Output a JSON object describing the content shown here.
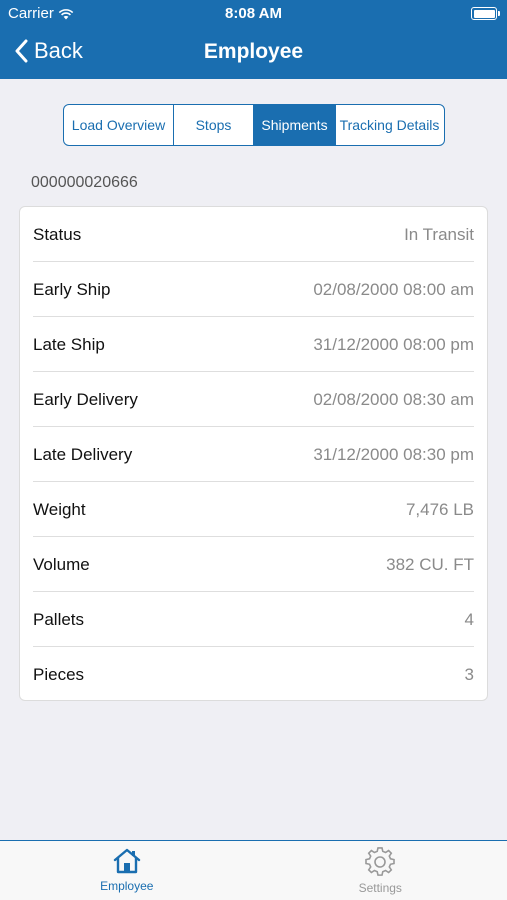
{
  "status_bar": {
    "carrier": "Carrier",
    "time": "8:08 AM"
  },
  "nav": {
    "back_label": "Back",
    "title": "Employee"
  },
  "segments": [
    {
      "label": "Load Overview",
      "active": false
    },
    {
      "label": "Stops",
      "active": false
    },
    {
      "label": "Shipments",
      "active": true
    },
    {
      "label": "Tracking Details",
      "active": false
    }
  ],
  "shipment_id": "000000020666",
  "details": [
    {
      "label": "Status",
      "value": "In Transit"
    },
    {
      "label": "Early Ship",
      "value": "02/08/2000 08:00 am"
    },
    {
      "label": "Late Ship",
      "value": "31/12/2000 08:00 pm"
    },
    {
      "label": "Early Delivery",
      "value": "02/08/2000 08:30 am"
    },
    {
      "label": "Late Delivery",
      "value": "31/12/2000 08:30 pm"
    },
    {
      "label": "Weight",
      "value": "7,476 LB"
    },
    {
      "label": "Volume",
      "value": "382 CU. FT"
    },
    {
      "label": "Pallets",
      "value": "4"
    },
    {
      "label": "Pieces",
      "value": "3"
    }
  ],
  "tabs": [
    {
      "label": "Employee",
      "icon": "home-icon",
      "active": true
    },
    {
      "label": "Settings",
      "icon": "gear-icon",
      "active": false
    }
  ],
  "colors": {
    "accent": "#1a6eb0",
    "background": "#efeff4"
  }
}
